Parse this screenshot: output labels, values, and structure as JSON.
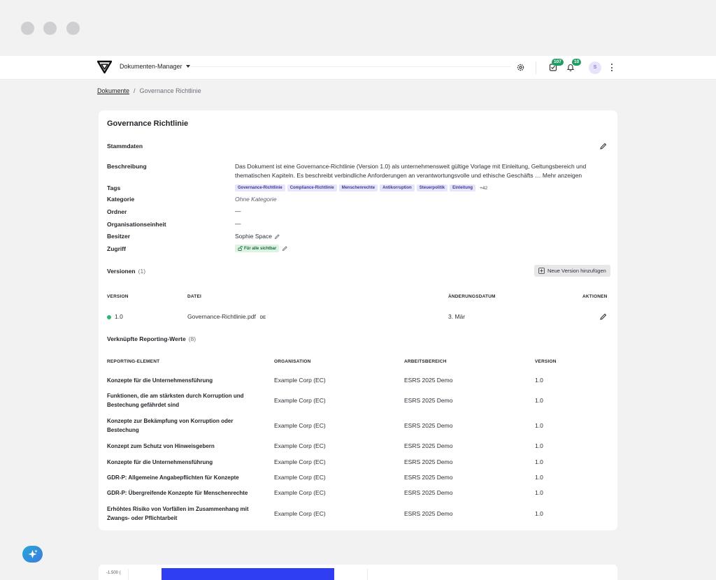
{
  "app": {
    "name": "Dokumenten-Manager"
  },
  "topbar": {
    "badge_tasks": "107",
    "badge_notifications": "10",
    "avatar_initial": "S"
  },
  "breadcrumb": {
    "root": "Dokumente",
    "separator": "/",
    "current": "Governance Richtlinie"
  },
  "document": {
    "title": "Governance Richtlinie",
    "stammdaten_label": "Stammdaten",
    "fields": {
      "beschreibung_label": "Beschreibung",
      "beschreibung_text": "Das Dokument ist eine Governance-Richtlinie (Version 1.0) als unternehmensweit gültige Vorlage mit Einleitung, Geltungsbereich und thematischen Kapiteln. Es beschreibt verbindliche Anforderungen an verantwortungsvolle und ethische Geschäfts …",
      "mehr_anzeigen": "Mehr anzeigen",
      "tags_label": "Tags",
      "tags": [
        "Governance-Richtlinie",
        "Compliance-Richtlinie",
        "Menschenrechte",
        "Antikorruption",
        "Steuerpolitik",
        "Einleitung"
      ],
      "tags_more": "+42",
      "kategorie_label": "Kategorie",
      "kategorie_value": "Ohne Kategorie",
      "ordner_label": "Ordner",
      "ordner_value": "—",
      "orgeinheit_label": "Organisationseinheit",
      "orgeinheit_value": "—",
      "besitzer_label": "Besitzer",
      "besitzer_value": "Sophie Space",
      "zugriff_label": "Zugriff",
      "zugriff_value": "Für alle sichtbar"
    }
  },
  "versions": {
    "label": "Versionen",
    "count": "(1)",
    "add_button": "Neue Version hinzufügen",
    "headers": {
      "version": "VERSION",
      "datei": "DATEI",
      "datum": "ÄNDERUNGSDATUM",
      "aktionen": "AKTIONEN"
    },
    "rows": [
      {
        "version": "1.0",
        "file": "Governance-Richtlinie.pdf",
        "lang": "DE",
        "date": "3. Mär"
      }
    ]
  },
  "reporting": {
    "label": "Verknüpfte Reporting-Werte",
    "count": "(8)",
    "headers": {
      "element": "REPORTING-ELEMENT",
      "org": "ORGANISATION",
      "bereich": "ARBEITSBEREICH",
      "version": "VERSION"
    },
    "rows": [
      {
        "element": "Konzepte für die Unternehmensführung",
        "org": "Example Corp (EC)",
        "bereich": "ESRS 2025 Demo",
        "version": "1.0"
      },
      {
        "element": "Funktionen, die am stärksten durch Korruption und Bestechung gefährdet sind",
        "org": "Example Corp (EC)",
        "bereich": "ESRS 2025 Demo",
        "version": "1.0"
      },
      {
        "element": "Konzepte zur Bekämpfung von Korruption oder Bestechung",
        "org": "Example Corp (EC)",
        "bereich": "ESRS 2025 Demo",
        "version": "1.0"
      },
      {
        "element": "Konzept zum Schutz von Hinweisgebern",
        "org": "Example Corp (EC)",
        "bereich": "ESRS 2025 Demo",
        "version": "1.0"
      },
      {
        "element": "Konzepte für die Unternehmensführung",
        "org": "Example Corp (EC)",
        "bereich": "ESRS 2025 Demo",
        "version": "1.0"
      },
      {
        "element": "GDR-P: Allgemeine Angabepflichten für Konzepte",
        "org": "Example Corp (EC)",
        "bereich": "ESRS 2025 Demo",
        "version": "1.0"
      },
      {
        "element": "GDR-P: Übergreifende Konzepte für Menschenrechte",
        "org": "Example Corp (EC)",
        "bereich": "ESRS 2025 Demo",
        "version": "1.0"
      },
      {
        "element": "Erhöhtes Risiko von Vorfällen im Zusammenhang mit Zwangs- oder Pflichtarbeit",
        "org": "Example Corp (EC)",
        "bereich": "ESRS 2025 Demo",
        "version": "1.0"
      }
    ]
  },
  "chart_peek": {
    "tick_label": "-1.500 ("
  },
  "colors": {
    "accent": "#2f3ef2",
    "success": "#1f9d63",
    "tag_bg": "#e6e5fb"
  }
}
